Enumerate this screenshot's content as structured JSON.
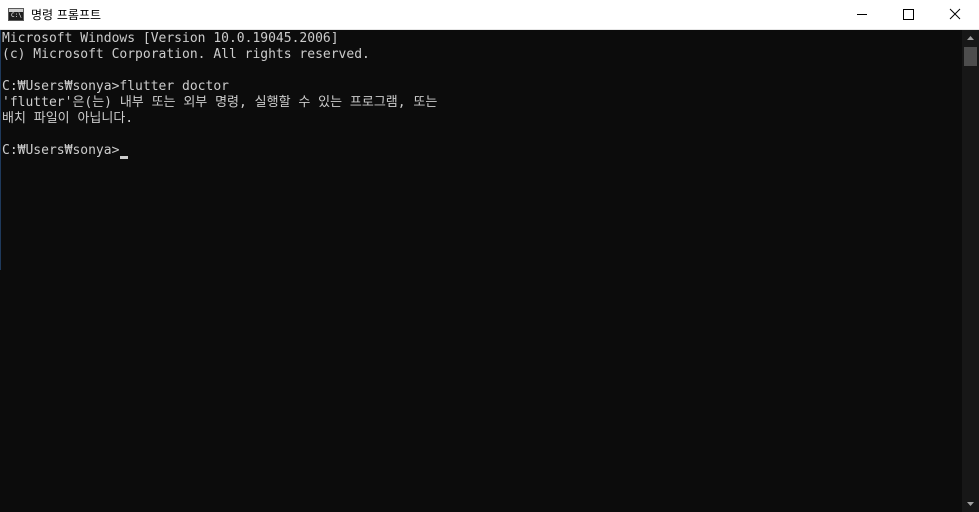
{
  "window": {
    "title": "명령 프롬프트",
    "icon": "cmd-icon",
    "icon_text": "C:\\"
  },
  "controls": {
    "minimize": "minimize-icon",
    "maximize": "maximize-icon",
    "close": "close-icon"
  },
  "console": {
    "lines": [
      "Microsoft Windows [Version 10.0.19045.2006]",
      "(c) Microsoft Corporation. All rights reserved.",
      "",
      "C:₩Users₩sonya>flutter doctor",
      "'flutter'은(는) 내부 또는 외부 명령, 실행할 수 있는 프로그램, 또는",
      "배치 파일이 아닙니다.",
      "",
      "C:₩Users₩sonya>"
    ]
  },
  "colors": {
    "background": "#0c0c0c",
    "text": "#cccccc",
    "titlebar": "#ffffff"
  }
}
